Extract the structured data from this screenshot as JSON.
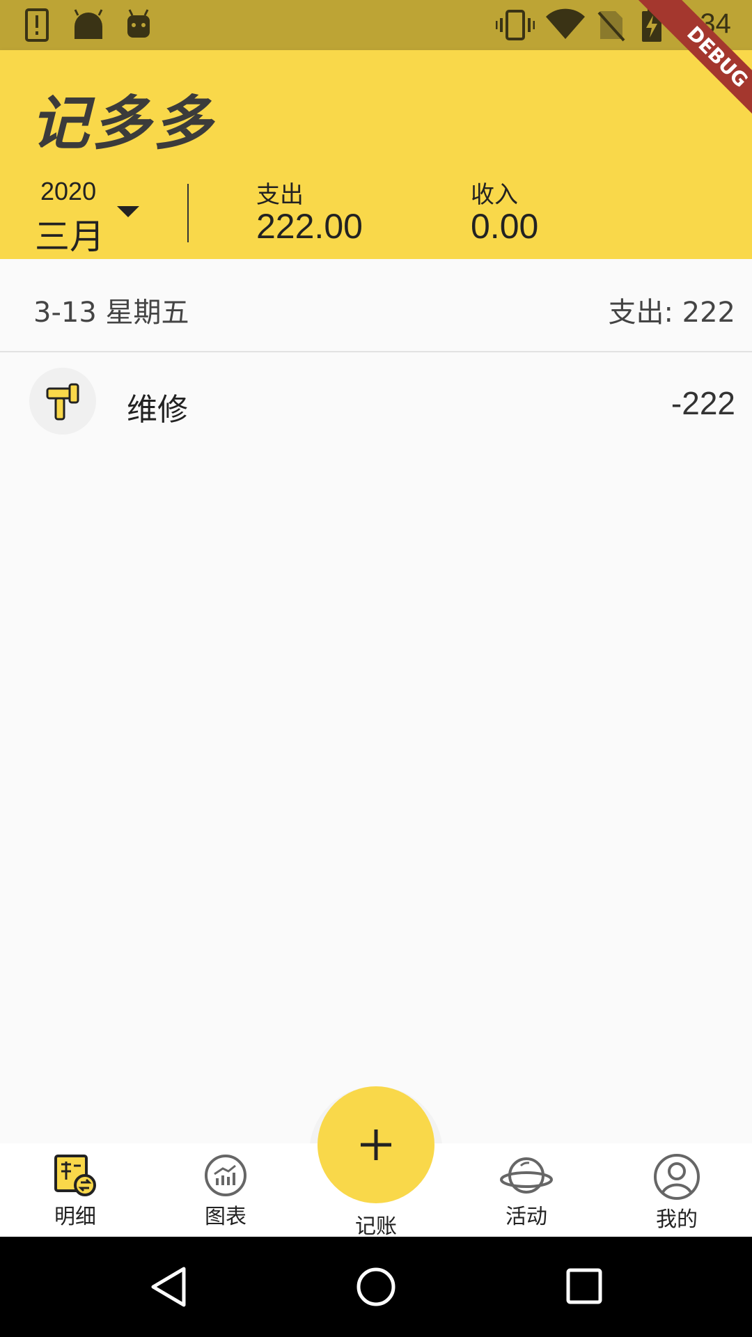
{
  "status_bar": {
    "time": "2:34",
    "icons": [
      "alert-icon",
      "android-icon",
      "android-head-icon",
      "vibrate-icon",
      "wifi-icon",
      "no-sim-icon",
      "battery-charging-icon"
    ]
  },
  "debug_banner": "DEBUG",
  "header": {
    "title": "记多多",
    "year": "2020",
    "month": "三月",
    "expense_label": "支出",
    "expense_value": "222.00",
    "income_label": "收入",
    "income_value": "0.00"
  },
  "days": [
    {
      "date": "3-13 星期五",
      "total": "支出: 222",
      "entries": [
        {
          "category": "维修",
          "icon": "repair-icon",
          "amount": "-222"
        }
      ]
    }
  ],
  "nav": {
    "items": [
      {
        "label": "明细",
        "icon": "ledger-icon"
      },
      {
        "label": "图表",
        "icon": "chart-icon"
      },
      {
        "label": "记账",
        "icon": "plus-icon"
      },
      {
        "label": "活动",
        "icon": "planet-icon"
      },
      {
        "label": "我的",
        "icon": "profile-icon"
      }
    ]
  },
  "colors": {
    "accent": "#f9d84a",
    "status_bar": "#bda435",
    "debug": "#a4372e"
  }
}
